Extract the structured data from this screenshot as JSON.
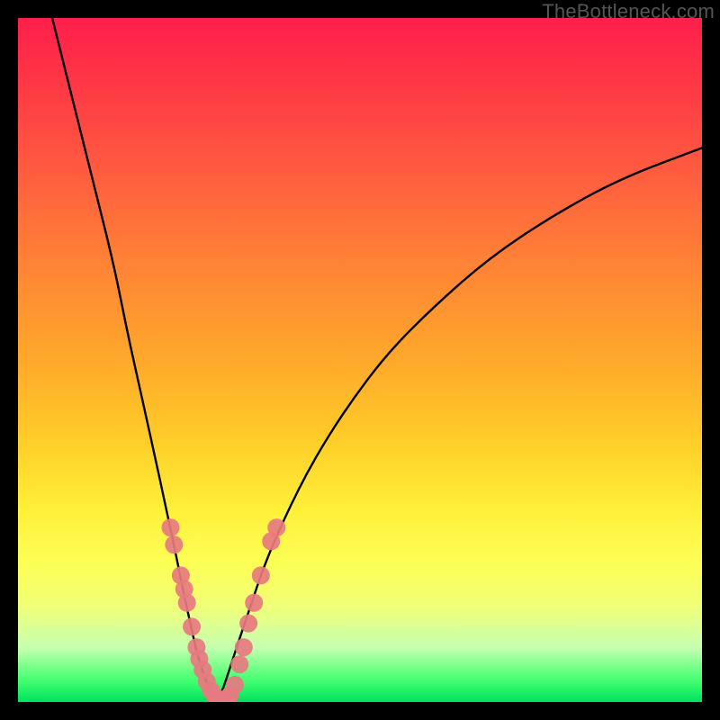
{
  "watermark": "TheBottleneck.com",
  "chart_data": {
    "type": "line",
    "title": "",
    "xlabel": "",
    "ylabel": "",
    "xlim": [
      0,
      100
    ],
    "ylim": [
      0,
      100
    ],
    "grid": false,
    "legend": false,
    "series": [
      {
        "name": "left-curve",
        "x": [
          5,
          8,
          11,
          14,
          16,
          18,
          20,
          21.5,
          23,
          24.2,
          25.3,
          26.2,
          27,
          27.7,
          28.3,
          28.8,
          29.2
        ],
        "y": [
          100,
          88,
          76,
          64,
          54,
          45,
          36,
          29,
          22,
          16,
          11,
          7,
          4.5,
          2.5,
          1.3,
          0.5,
          0
        ]
      },
      {
        "name": "right-curve",
        "x": [
          29.2,
          30,
          31,
          32.3,
          34,
          36,
          39,
          43,
          48,
          54,
          61,
          69,
          78,
          88,
          100
        ],
        "y": [
          0,
          2,
          5,
          9,
          14,
          20,
          27,
          35,
          43,
          51,
          58,
          65,
          71,
          76.5,
          81
        ]
      }
    ],
    "data_points": {
      "name": "highlighted-points",
      "color": "#e77a80",
      "points": [
        {
          "x": 22.3,
          "y": 25.5
        },
        {
          "x": 22.8,
          "y": 23.0
        },
        {
          "x": 23.8,
          "y": 18.5
        },
        {
          "x": 24.3,
          "y": 16.5
        },
        {
          "x": 24.7,
          "y": 14.5
        },
        {
          "x": 25.4,
          "y": 11.0
        },
        {
          "x": 26.1,
          "y": 8.0
        },
        {
          "x": 26.5,
          "y": 6.3
        },
        {
          "x": 27.0,
          "y": 4.7
        },
        {
          "x": 27.6,
          "y": 3.0
        },
        {
          "x": 28.2,
          "y": 1.7
        },
        {
          "x": 28.8,
          "y": 0.8
        },
        {
          "x": 29.5,
          "y": 0.3
        },
        {
          "x": 30.3,
          "y": 0.3
        },
        {
          "x": 31.0,
          "y": 1.0
        },
        {
          "x": 31.7,
          "y": 2.5
        },
        {
          "x": 32.4,
          "y": 5.5
        },
        {
          "x": 33.0,
          "y": 8.0
        },
        {
          "x": 33.7,
          "y": 11.5
        },
        {
          "x": 34.5,
          "y": 14.5
        },
        {
          "x": 35.5,
          "y": 18.5
        },
        {
          "x": 37.0,
          "y": 23.5
        },
        {
          "x": 37.8,
          "y": 25.5
        }
      ]
    },
    "background_gradient": {
      "top": "#ff1f4b",
      "mid1": "#ff8335",
      "mid2": "#fff03a",
      "bottom": "#00e060"
    }
  }
}
